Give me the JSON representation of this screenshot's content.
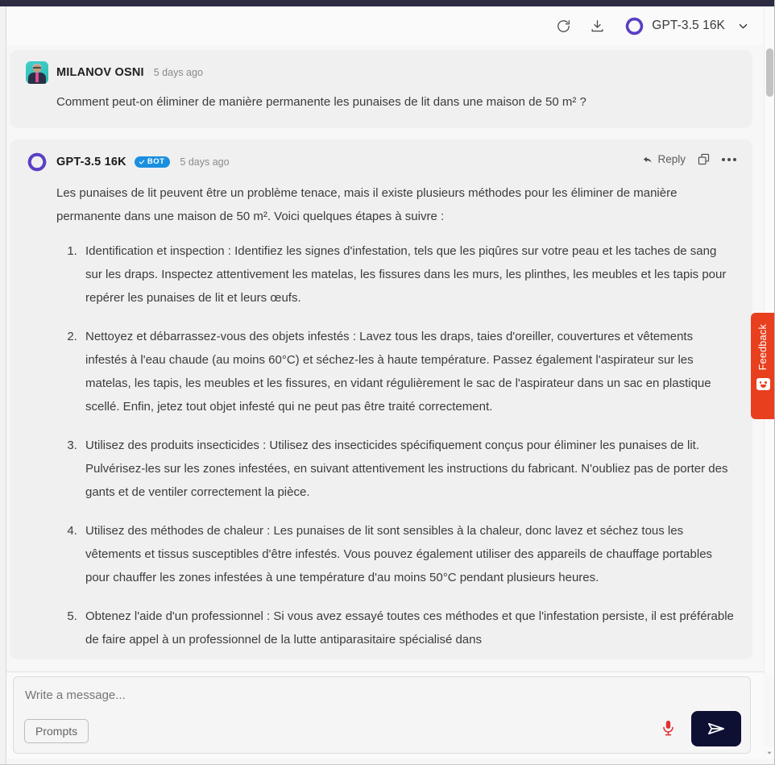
{
  "header": {
    "refresh_icon": "refresh-icon",
    "download_icon": "download-icon",
    "model_logo": "openai-logo-icon",
    "model_name": "GPT-3.5 16K",
    "chevron_icon": "chevron-down-icon"
  },
  "messages": [
    {
      "sender": "MILANOV OSNI",
      "timestamp": "5 days ago",
      "is_bot": false,
      "avatar": "user-avatar-photo",
      "text": "Comment peut-on éliminer de manière permanente les punaises de lit dans une maison de 50 m² ?"
    },
    {
      "sender": "GPT-3.5 16K",
      "badge": "BOT",
      "timestamp": "5 days ago",
      "is_bot": true,
      "avatar": "openai-logo-icon",
      "intro": "Les punaises de lit peuvent être un problème tenace, mais il existe plusieurs méthodes pour les éliminer de manière permanente dans une maison de 50 m². Voici quelques étapes à suivre :",
      "steps": [
        "Identification et inspection : Identifiez les signes d'infestation, tels que les piqûres sur votre peau et les taches de sang sur les draps. Inspectez attentivement les matelas, les fissures dans les murs, les plinthes, les meubles et les tapis pour repérer les punaises de lit et leurs œufs.",
        "Nettoyez et débarrassez-vous des objets infestés : Lavez tous les draps, taies d'oreiller, couvertures et vêtements infestés à l'eau chaude (au moins 60°C) et séchez-les à haute température. Passez également l'aspirateur sur les matelas, les tapis, les meubles et les fissures, en vidant régulièrement le sac de l'aspirateur dans un sac en plastique scellé. Enfin, jetez tout objet infesté qui ne peut pas être traité correctement.",
        "Utilisez des produits insecticides : Utilisez des insecticides spécifiquement conçus pour éliminer les punaises de lit. Pulvérisez-les sur les zones infestées, en suivant attentivement les instructions du fabricant. N'oubliez pas de porter des gants et de ventiler correctement la pièce.",
        "Utilisez des méthodes de chaleur : Les punaises de lit sont sensibles à la chaleur, donc lavez et séchez tous les vêtements et tissus susceptibles d'être infestés. Vous pouvez également utiliser des appareils de chauffage portables pour chauffer les zones infestées à une température d'au moins 50°C pendant plusieurs heures.",
        "Obtenez l'aide d'un professionnel : Si vous avez essayé toutes ces méthodes et que l'infestation persiste, il est préférable de faire appel à un professionnel de la lutte antiparasitaire spécialisé dans"
      ],
      "actions": {
        "reply_label": "Reply",
        "copy_icon": "copy-icon",
        "more_icon": "more-options-icon"
      }
    }
  ],
  "feedback_tab": {
    "label": "Feedback",
    "icon": "smiley-face-icon",
    "color": "#e8401f"
  },
  "composer": {
    "placeholder": "Write a message...",
    "value": "",
    "prompts_label": "Prompts",
    "mic_icon": "microphone-icon",
    "send_icon": "send-paper-plane-icon",
    "send_color": "#0d1033",
    "mic_color": "#e03030"
  }
}
